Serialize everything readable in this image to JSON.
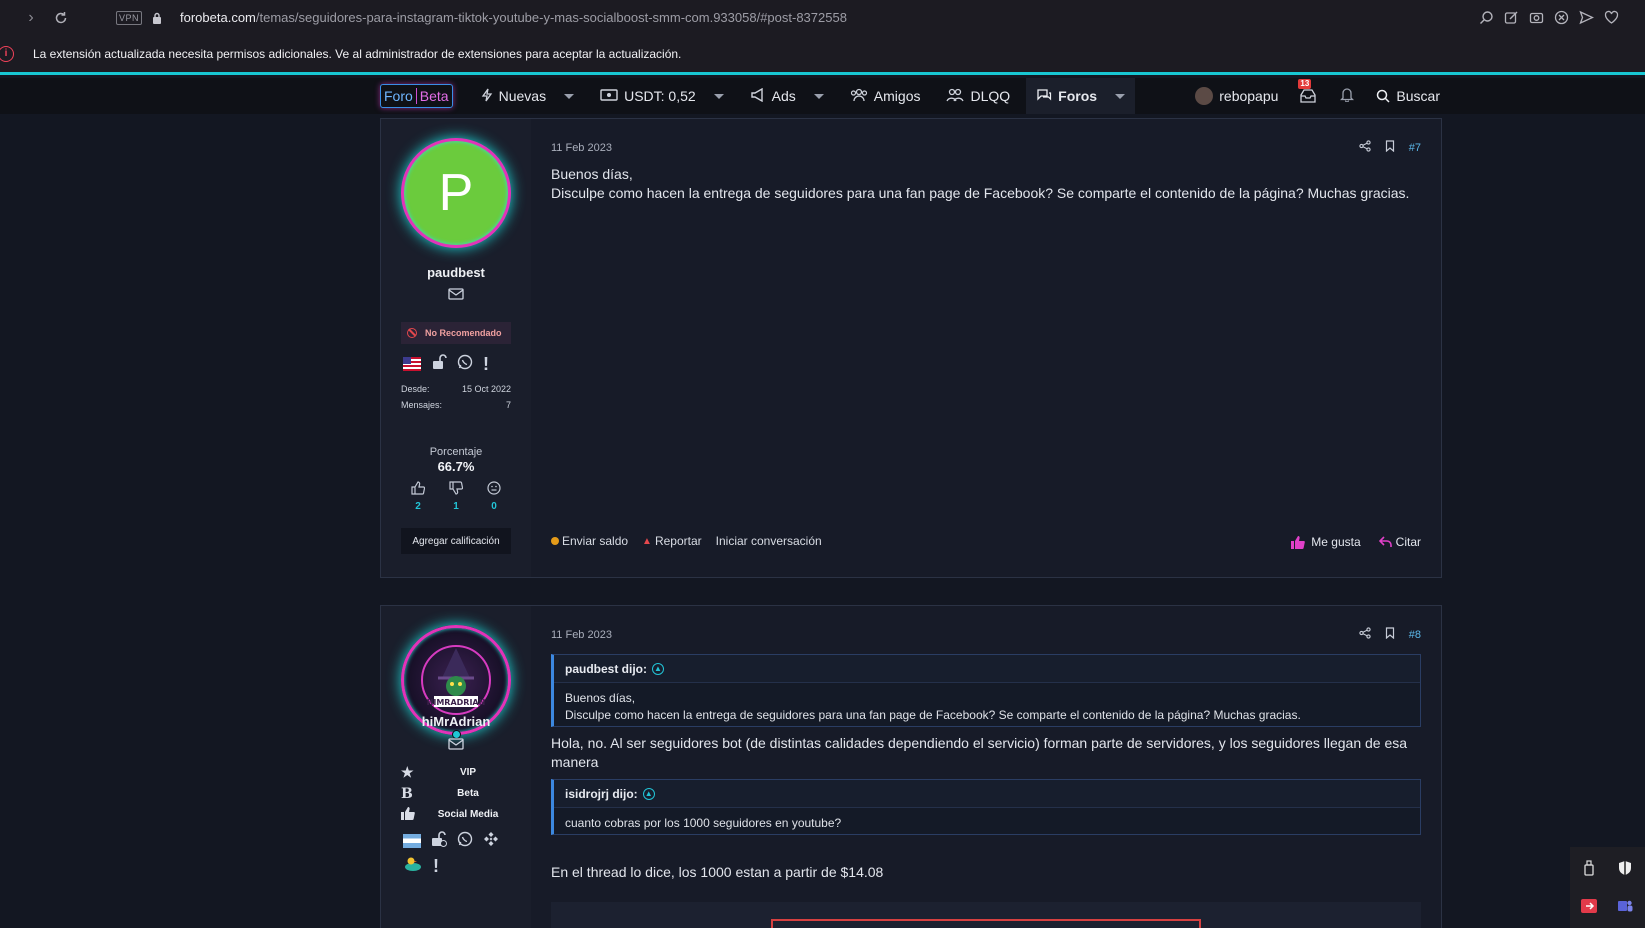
{
  "browser": {
    "url_host": "forobeta.com",
    "url_path": "/temas/seguidores-para-instagram-tiktok-youtube-y-mas-socialboost-smm-com.933058/#post-8372558",
    "vpn_label": "VPN"
  },
  "extension_banner": {
    "text": "La extensión actualizada necesita permisos adicionales. Ve al administrador de extensiones para aceptar la actualización."
  },
  "site_nav": {
    "logo_part1": "Foro",
    "logo_part2": "Beta",
    "items": [
      {
        "label": "Nuevas",
        "icon": "bolt-icon"
      },
      {
        "label": "USDT: 0,52",
        "icon": "money-icon"
      },
      {
        "label": "Ads",
        "icon": "megaphone-icon"
      },
      {
        "label": "Amigos",
        "icon": "users-icon"
      },
      {
        "label": "DLQQ",
        "icon": "people-icon"
      },
      {
        "label": "Foros",
        "icon": "chat-icon"
      }
    ],
    "username": "rebopapu",
    "inbox_count": "13",
    "search_label": "Buscar"
  },
  "posts": [
    {
      "avatar_letter": "P",
      "username": "paudbest",
      "status_label": "No Recomendado",
      "since_label": "Desde:",
      "since_value": "15 Oct 2022",
      "messages_label": "Mensajes:",
      "messages_value": "7",
      "percentage_label": "Porcentaje",
      "percentage_value": "66.7%",
      "votes_up": "2",
      "votes_down": "1",
      "votes_neutral": "0",
      "add_rating_label": "Agregar calificación",
      "date": "11 Feb 2023",
      "number": "#7",
      "message_line1": "Buenos días,",
      "message_line2": "Disculpe como hacen la entrega de seguidores para una fan page de Facebook? Se comparte el contenido de la página? Muchas gracias.",
      "send_balance": "Enviar saldo",
      "report": "Reportar",
      "start_conversation": "Iniciar conversación",
      "like": "Me gusta",
      "quote": "Citar"
    },
    {
      "username": "hiMrAdrian",
      "avatar_text": "HIMRADRIAN",
      "roles": [
        "VIP",
        "Beta",
        "Social Media"
      ],
      "date": "11 Feb 2023",
      "number": "#8",
      "quote1_author": "paudbest dijo:",
      "quote1_line1": "Buenos días,",
      "quote1_line2": "Disculpe como hacen la entrega de seguidores para una fan page de Facebook? Se comparte el contenido de la página? Muchas gracias.",
      "reply1": "Hola, no. Al ser seguidores bot (de distintas calidades dependiendo el servicio) forman parte de servidores, y los seguidores llegan de esa manera",
      "quote2_author": "isidrojrj dijo:",
      "quote2_line1": "cuanto cobras por los 1000 seguidores en youtube?",
      "reply2": "En el thread lo dice, los 1000 estan a partir de $14.08"
    }
  ]
}
